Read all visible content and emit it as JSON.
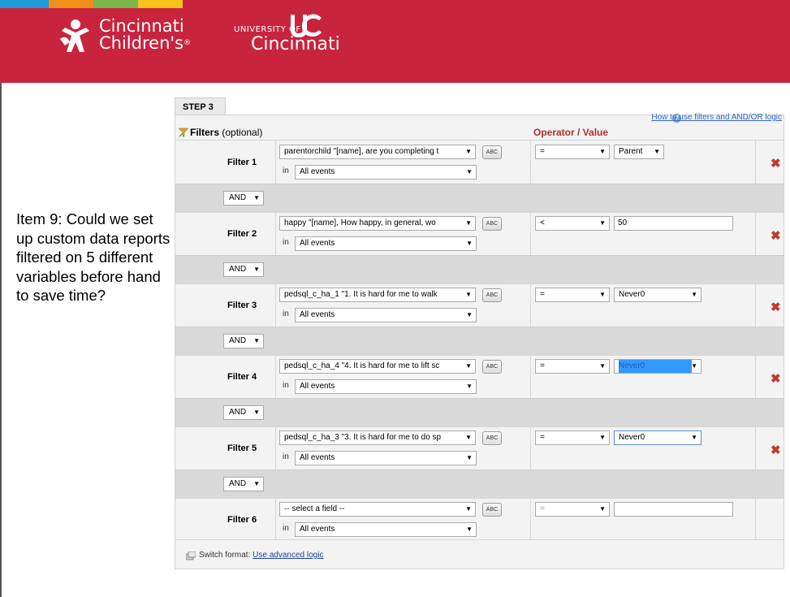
{
  "header": {
    "colors": {
      "banner": "#c8243e",
      "stripe_blue": "#1f9ad6",
      "stripe_orange": "#f18f1b",
      "stripe_green": "#7ab648",
      "stripe_yellow": "#f7c21b"
    },
    "cchildrens_line1": "Cincinnati",
    "cchildrens_line2": "Children's",
    "registered_mark": "®",
    "uc_small": "UNIVERSITY OF",
    "uc_city": "Cincinnati",
    "uc_mark_icon": "uc-monogram-icon",
    "cch_logo_icon": "cincinnati-childrens-logo-icon"
  },
  "question": {
    "text": "Item 9: Could we set up custom data reports filtered on 5 different variables before hand to save time?"
  },
  "panel": {
    "step_tab": "STEP 3",
    "help_link": "How to use filters and AND/OR logic",
    "filters_label": "Filters",
    "filters_optional": "(optional)",
    "operator_header": "Operator / Value",
    "in_label": "in",
    "abc_button_label": "ABC",
    "connector_value": "AND",
    "filters": [
      {
        "label": "Filter 1",
        "field": "parentorchild \"[name], are you completing t",
        "event": "All events",
        "operator": "=",
        "value": "Parent",
        "value_type": "select",
        "deletable": true
      },
      {
        "label": "Filter 2",
        "field": "happy \"[name], How happy, in general, wo",
        "event": "All events",
        "operator": "<",
        "value": "50",
        "value_type": "text",
        "deletable": true
      },
      {
        "label": "Filter 3",
        "field": "pedsql_c_ha_1 \"1. It is hard for me to walk",
        "event": "All events",
        "operator": "=",
        "value": "Never0",
        "value_type": "select",
        "deletable": true
      },
      {
        "label": "Filter 4",
        "field": "pedsql_c_ha_4 \"4. It is hard for me to lift sc",
        "event": "All events",
        "operator": "=",
        "value": "Never0",
        "value_type": "select-highlighted",
        "deletable": true
      },
      {
        "label": "Filter 5",
        "field": "pedsql_c_ha_3 \"3. It is hard for me to do sp",
        "event": "All events",
        "operator": "=",
        "value": "Never0",
        "value_type": "select",
        "deletable": true
      },
      {
        "label": "Filter 6",
        "field": "-- select a field --",
        "event": "All events",
        "operator": "=",
        "value": "",
        "value_type": "text",
        "deletable": false
      }
    ],
    "footer": {
      "switch_format": "Switch format:",
      "advanced_link": "Use advanced logic"
    }
  }
}
